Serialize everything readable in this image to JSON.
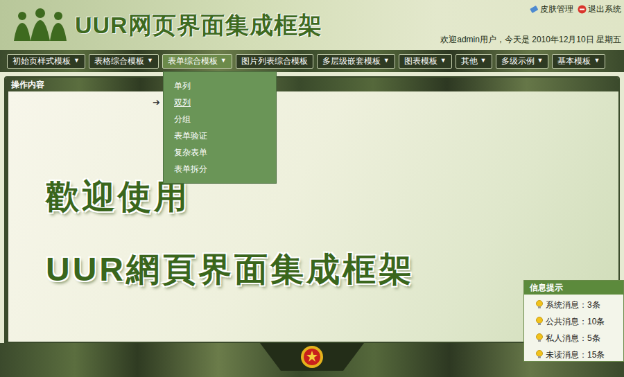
{
  "header": {
    "title": "UUR网页界面集成框架",
    "links": [
      "皮肤管理",
      "退出系统"
    ],
    "welcome": "欢迎admin用户，今天是 2010年12月10日 星期五"
  },
  "nav": [
    {
      "label": "初始页样式模板",
      "arrow": "▼",
      "expanded": false
    },
    {
      "label": "表格综合模板",
      "arrow": "▼",
      "expanded": false
    },
    {
      "label": "表单综合模板",
      "arrow": "▼",
      "expanded": true
    },
    {
      "label": "图片列表综合模板",
      "expanded": false
    },
    {
      "label": "多层级嵌套模板",
      "arrow": "▼",
      "expanded": false
    },
    {
      "label": "图表模板",
      "arrow": "▼",
      "expanded": false
    },
    {
      "label": "其他",
      "arrow": "▼",
      "expanded": false
    },
    {
      "label": "多级示例",
      "arrow": "▼",
      "expanded": false
    },
    {
      "label": "基本模板",
      "arrow": "▼",
      "expanded": false
    }
  ],
  "dropdown": [
    {
      "label": "单列",
      "selected": false
    },
    {
      "label": "双列",
      "selected": true
    },
    {
      "label": "分组",
      "selected": false
    },
    {
      "label": "表单验证",
      "selected": false
    },
    {
      "label": "复杂表单",
      "selected": false
    },
    {
      "label": "表单拆分",
      "selected": false
    }
  ],
  "panel": {
    "title": "操作内容",
    "pointer": "➔",
    "welcome_lines": [
      "歡迎使用",
      "UUR網頁界面集成框架"
    ]
  },
  "info": {
    "title": "信息提示",
    "items": [
      "系统消息：3条",
      "公共消息：10条",
      "私人消息：5条",
      "未读消息：15条"
    ]
  }
}
